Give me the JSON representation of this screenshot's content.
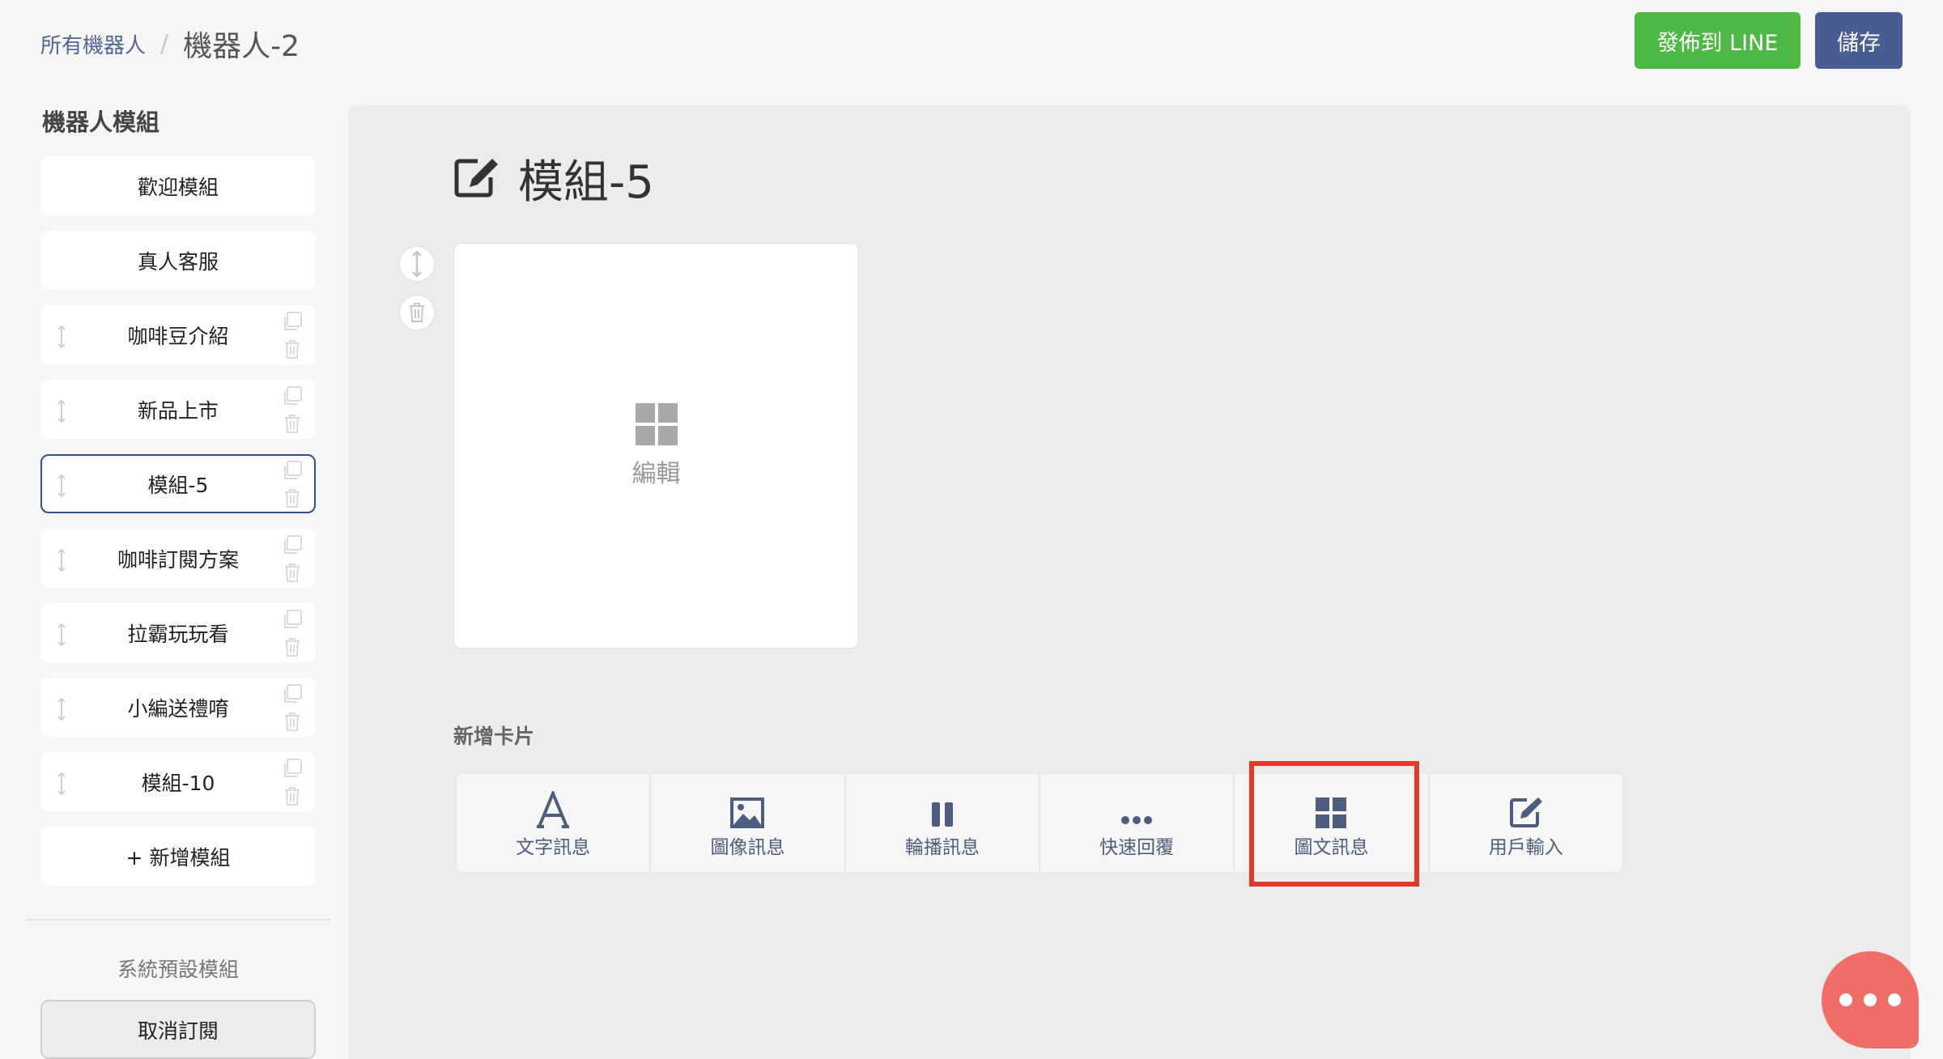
{
  "breadcrumb": {
    "root": "所有機器人",
    "separator": "/",
    "current": "機器人-2"
  },
  "header": {
    "publish_label": "發佈到 LINE",
    "save_label": "儲存"
  },
  "sidebar": {
    "title": "機器人模組",
    "modules": [
      {
        "label": "歡迎模組"
      },
      {
        "label": "真人客服"
      },
      {
        "label": "咖啡豆介紹"
      },
      {
        "label": "新品上市"
      },
      {
        "label": "模組-5"
      },
      {
        "label": "咖啡訂閱方案"
      },
      {
        "label": "拉霸玩玩看"
      },
      {
        "label": "小編送禮唷"
      },
      {
        "label": "模組-10"
      },
      {
        "label": "+ 新增模組"
      }
    ],
    "system_title": "系統預設模組",
    "unsubscribe_label": "取消訂閱"
  },
  "main": {
    "module_title": "模組-5",
    "card": {
      "label": "編輯",
      "icon": "grid-icon"
    },
    "add_card_title": "新增卡片",
    "tools": [
      {
        "label": "文字訊息",
        "icon": "text-a-icon"
      },
      {
        "label": "圖像訊息",
        "icon": "image-icon"
      },
      {
        "label": "輪播訊息",
        "icon": "carousel-icon"
      },
      {
        "label": "快速回覆",
        "icon": "more-dots-icon"
      },
      {
        "label": "圖文訊息",
        "icon": "grid-icon"
      },
      {
        "label": "用戶輸入",
        "icon": "edit-icon"
      }
    ]
  },
  "colors": {
    "publish": "#4db844",
    "save": "#4a5d92",
    "active_border": "#34508a",
    "highlight": "#e03a2a",
    "chat": "#ef6e67"
  }
}
